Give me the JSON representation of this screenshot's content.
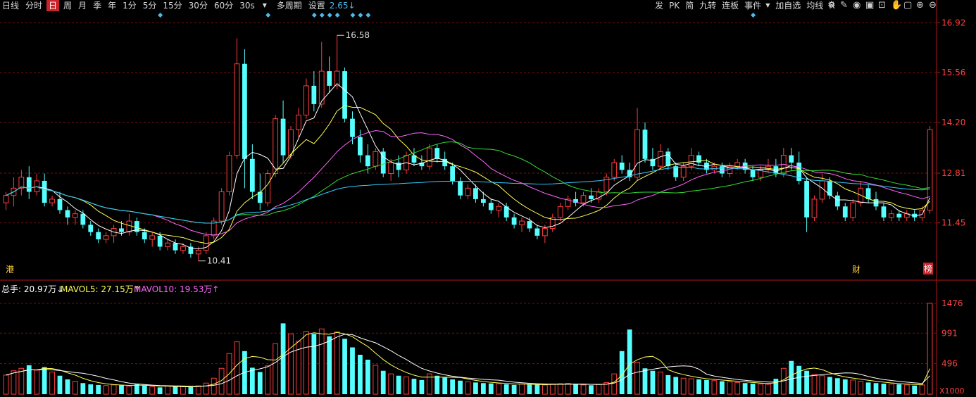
{
  "toolbar": {
    "left": [
      "日线",
      "分时",
      "日",
      "周",
      "月",
      "季",
      "年",
      "1分",
      "5分",
      "15分",
      "30分",
      "60分",
      "30s",
      "多周期",
      "设置"
    ],
    "selected": "日",
    "dropdown_value": "30s",
    "partial_value": "2.65↓",
    "right": [
      "发",
      "PK",
      "简",
      "九转",
      "连板",
      "事件",
      "加自选",
      "均线",
      "R"
    ]
  },
  "icons": [
    "gear-icon",
    "pencil-icon",
    "eye-icon",
    "box-icon",
    "lock-icon",
    "hand-icon",
    "window-icon",
    "zoom-in-icon",
    "zoom-out-icon"
  ],
  "markers": {
    "bottom_left": "港",
    "bottom_right_a": "财",
    "bottom_right_b": "榜"
  },
  "price_axis": {
    "ticks": [
      "16.92",
      "15.56",
      "14.20",
      "12.81",
      "11.45"
    ]
  },
  "volume_axis": {
    "ticks": [
      "1476",
      "991",
      "496"
    ],
    "unit": "X1000"
  },
  "volume_legend": {
    "total": "总手: 20.97万↓",
    "mavol5": "MAVOL5: 27.15万↑",
    "mavol10": "MAVOL10: 19.53万↑"
  },
  "annotations": {
    "high": "16.58",
    "low": "10.41"
  },
  "colors": {
    "up": "#ff3c3c",
    "down": "#54ffff",
    "ma5": "#ffffff",
    "ma10": "#ffff55",
    "ma20": "#ff66ff",
    "ma30": "#33dd33",
    "ma60": "#33ccff",
    "grid": "#7a1010",
    "axis_text": "#ff4040"
  },
  "chart_data": {
    "type": "candlestick",
    "ohlc": [
      [
        12.0,
        12.3,
        11.8,
        12.2
      ],
      [
        12.2,
        12.7,
        11.9,
        12.4
      ],
      [
        12.4,
        12.9,
        12.2,
        12.7
      ],
      [
        12.7,
        13.0,
        12.1,
        12.3
      ],
      [
        12.3,
        12.8,
        12.2,
        12.6
      ],
      [
        12.6,
        12.8,
        11.9,
        12.0
      ],
      [
        12.0,
        12.2,
        11.9,
        12.1
      ],
      [
        12.1,
        12.3,
        11.7,
        11.8
      ],
      [
        11.8,
        11.9,
        11.4,
        11.6
      ],
      [
        11.6,
        11.8,
        11.4,
        11.7
      ],
      [
        11.7,
        11.8,
        11.3,
        11.4
      ],
      [
        11.4,
        11.5,
        11.1,
        11.2
      ],
      [
        11.2,
        11.3,
        10.9,
        11.0
      ],
      [
        11.0,
        11.2,
        10.9,
        11.1
      ],
      [
        11.1,
        11.4,
        10.9,
        11.3
      ],
      [
        11.3,
        11.5,
        11.1,
        11.2
      ],
      [
        11.2,
        11.7,
        11.1,
        11.5
      ],
      [
        11.5,
        11.6,
        11.1,
        11.2
      ],
      [
        11.2,
        11.3,
        10.9,
        11.0
      ],
      [
        11.0,
        11.2,
        10.8,
        11.1
      ],
      [
        11.1,
        11.2,
        10.7,
        10.8
      ],
      [
        10.8,
        11.0,
        10.7,
        10.9
      ],
      [
        10.9,
        11.0,
        10.6,
        10.7
      ],
      [
        10.7,
        10.9,
        10.6,
        10.8
      ],
      [
        10.8,
        10.9,
        10.5,
        10.6
      ],
      [
        10.6,
        10.8,
        10.41,
        10.7
      ],
      [
        10.7,
        11.2,
        10.6,
        11.1
      ],
      [
        11.1,
        11.6,
        11.0,
        11.5
      ],
      [
        11.5,
        12.4,
        11.4,
        12.3
      ],
      [
        12.3,
        13.4,
        12.2,
        13.3
      ],
      [
        13.3,
        16.5,
        13.2,
        15.8
      ],
      [
        15.8,
        16.2,
        12.4,
        13.2
      ],
      [
        13.2,
        13.6,
        12.1,
        12.3
      ],
      [
        12.3,
        12.8,
        11.8,
        12.0
      ],
      [
        12.0,
        12.9,
        11.9,
        12.8
      ],
      [
        12.8,
        14.4,
        12.7,
        14.3
      ],
      [
        14.3,
        14.8,
        13.1,
        13.3
      ],
      [
        13.3,
        14.1,
        13.2,
        14.0
      ],
      [
        14.0,
        14.6,
        13.8,
        14.4
      ],
      [
        14.4,
        15.4,
        14.3,
        15.2
      ],
      [
        15.2,
        15.6,
        14.5,
        14.7
      ],
      [
        14.7,
        16.4,
        14.6,
        15.6
      ],
      [
        15.6,
        16.0,
        15.0,
        15.2
      ],
      [
        15.2,
        16.58,
        15.1,
        15.6
      ],
      [
        15.6,
        15.7,
        14.2,
        14.3
      ],
      [
        14.3,
        14.5,
        13.6,
        13.8
      ],
      [
        13.8,
        14.0,
        13.1,
        13.3
      ],
      [
        13.3,
        13.6,
        12.8,
        13.0
      ],
      [
        13.0,
        13.5,
        12.9,
        13.4
      ],
      [
        13.4,
        13.5,
        12.7,
        12.8
      ],
      [
        12.8,
        13.2,
        12.6,
        13.1
      ],
      [
        13.1,
        13.3,
        12.7,
        12.9
      ],
      [
        12.9,
        13.4,
        12.8,
        13.3
      ],
      [
        13.3,
        13.5,
        13.0,
        13.1
      ],
      [
        13.1,
        13.3,
        12.9,
        13.0
      ],
      [
        13.0,
        13.6,
        12.9,
        13.5
      ],
      [
        13.5,
        13.6,
        13.1,
        13.2
      ],
      [
        13.2,
        13.4,
        12.9,
        13.0
      ],
      [
        13.0,
        13.1,
        12.5,
        12.6
      ],
      [
        12.6,
        12.7,
        12.1,
        12.2
      ],
      [
        12.2,
        12.5,
        12.1,
        12.4
      ],
      [
        12.4,
        12.5,
        12.0,
        12.1
      ],
      [
        12.1,
        12.3,
        11.9,
        12.0
      ],
      [
        12.0,
        12.1,
        11.7,
        11.8
      ],
      [
        11.8,
        12.0,
        11.6,
        11.9
      ],
      [
        11.9,
        12.0,
        11.5,
        11.6
      ],
      [
        11.6,
        11.7,
        11.3,
        11.4
      ],
      [
        11.4,
        11.6,
        11.2,
        11.5
      ],
      [
        11.5,
        11.6,
        11.2,
        11.3
      ],
      [
        11.3,
        11.4,
        11.0,
        11.1
      ],
      [
        11.1,
        11.4,
        10.9,
        11.3
      ],
      [
        11.3,
        11.7,
        11.2,
        11.6
      ],
      [
        11.6,
        12.0,
        11.5,
        11.9
      ],
      [
        11.9,
        12.2,
        11.8,
        12.1
      ],
      [
        12.1,
        12.3,
        11.9,
        12.0
      ],
      [
        12.0,
        12.3,
        11.9,
        12.2
      ],
      [
        12.2,
        12.4,
        12.0,
        12.1
      ],
      [
        12.1,
        12.4,
        12.0,
        12.3
      ],
      [
        12.3,
        12.8,
        12.2,
        12.7
      ],
      [
        12.7,
        13.2,
        12.6,
        13.1
      ],
      [
        13.1,
        13.3,
        12.8,
        12.9
      ],
      [
        12.9,
        13.1,
        12.6,
        12.7
      ],
      [
        12.7,
        14.6,
        12.6,
        14.0
      ],
      [
        14.0,
        14.2,
        13.1,
        13.2
      ],
      [
        13.2,
        13.5,
        12.9,
        13.0
      ],
      [
        13.0,
        13.6,
        12.9,
        13.4
      ],
      [
        13.4,
        13.5,
        12.9,
        13.0
      ],
      [
        13.0,
        13.1,
        12.6,
        12.7
      ],
      [
        12.7,
        13.1,
        12.6,
        13.0
      ],
      [
        13.0,
        13.5,
        12.9,
        13.3
      ],
      [
        13.3,
        13.4,
        13.0,
        13.1
      ],
      [
        13.1,
        13.2,
        12.8,
        12.9
      ],
      [
        12.9,
        13.1,
        12.8,
        13.0
      ],
      [
        13.0,
        13.1,
        12.7,
        12.8
      ],
      [
        12.8,
        13.1,
        12.7,
        13.0
      ],
      [
        13.0,
        13.2,
        12.9,
        13.1
      ],
      [
        13.1,
        13.2,
        12.8,
        12.9
      ],
      [
        12.9,
        13.0,
        12.6,
        12.7
      ],
      [
        12.7,
        13.0,
        12.6,
        12.9
      ],
      [
        12.9,
        13.2,
        12.8,
        13.0
      ],
      [
        13.0,
        13.2,
        12.7,
        12.8
      ],
      [
        12.8,
        13.5,
        12.7,
        13.3
      ],
      [
        13.3,
        13.5,
        12.9,
        13.1
      ],
      [
        13.1,
        13.4,
        12.5,
        12.6
      ],
      [
        12.6,
        12.7,
        11.2,
        11.6
      ],
      [
        11.6,
        12.2,
        11.5,
        12.1
      ],
      [
        12.1,
        12.8,
        12.0,
        12.6
      ],
      [
        12.6,
        12.7,
        12.1,
        12.2
      ],
      [
        12.2,
        12.3,
        11.8,
        11.9
      ],
      [
        11.9,
        12.0,
        11.5,
        11.6
      ],
      [
        11.6,
        12.1,
        11.5,
        12.0
      ],
      [
        12.0,
        12.6,
        11.9,
        12.4
      ],
      [
        12.4,
        12.5,
        12.0,
        12.1
      ],
      [
        12.1,
        12.3,
        11.8,
        11.9
      ],
      [
        11.9,
        12.0,
        11.5,
        11.6
      ],
      [
        11.6,
        11.8,
        11.5,
        11.7
      ],
      [
        11.7,
        11.8,
        11.5,
        11.6
      ],
      [
        11.6,
        11.8,
        11.5,
        11.7
      ],
      [
        11.7,
        11.8,
        11.5,
        11.6
      ],
      [
        11.6,
        11.9,
        11.5,
        11.8
      ],
      [
        11.8,
        14.1,
        11.7,
        14.0
      ]
    ],
    "volume_k": [
      310,
      380,
      420,
      470,
      390,
      440,
      360,
      300,
      240,
      210,
      180,
      160,
      150,
      140,
      150,
      145,
      130,
      160,
      140,
      120,
      110,
      130,
      125,
      120,
      115,
      135,
      180,
      260,
      420,
      660,
      850,
      700,
      430,
      360,
      460,
      820,
      1150,
      980,
      860,
      1020,
      980,
      1060,
      940,
      1010,
      900,
      760,
      640,
      560,
      470,
      380,
      330,
      300,
      280,
      250,
      230,
      330,
      300,
      270,
      240,
      220,
      200,
      190,
      180,
      175,
      170,
      160,
      150,
      165,
      160,
      155,
      150,
      165,
      170,
      175,
      160,
      150,
      145,
      160,
      190,
      330,
      700,
      1050,
      520,
      420,
      380,
      360,
      310,
      280,
      260,
      250,
      240,
      230,
      220,
      210,
      200,
      190,
      180,
      170,
      165,
      160,
      250,
      420,
      540,
      460,
      380,
      320,
      300,
      280,
      260,
      240,
      230,
      210,
      190,
      180,
      170,
      165,
      160,
      150,
      140,
      150,
      1476
    ],
    "ma_periods": [
      5,
      10,
      20,
      30,
      60
    ]
  }
}
